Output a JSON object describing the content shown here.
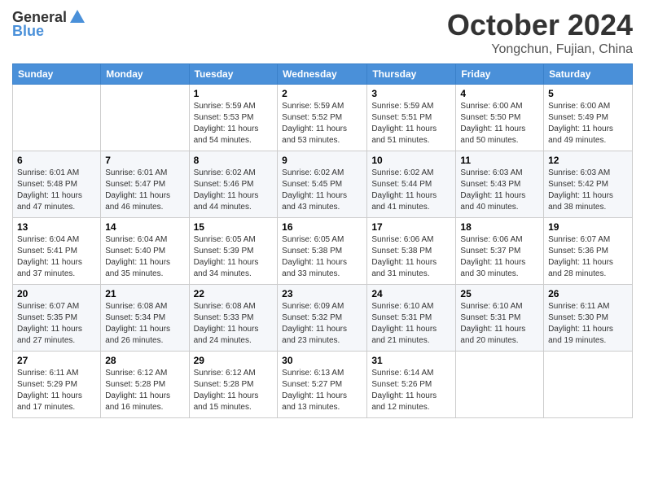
{
  "logo": {
    "general": "General",
    "blue": "Blue"
  },
  "title": "October 2024",
  "location": "Yongchun, Fujian, China",
  "days_of_week": [
    "Sunday",
    "Monday",
    "Tuesday",
    "Wednesday",
    "Thursday",
    "Friday",
    "Saturday"
  ],
  "weeks": [
    [
      {
        "day": "",
        "sunrise": "",
        "sunset": "",
        "daylight": ""
      },
      {
        "day": "",
        "sunrise": "",
        "sunset": "",
        "daylight": ""
      },
      {
        "day": "1",
        "sunrise": "Sunrise: 5:59 AM",
        "sunset": "Sunset: 5:53 PM",
        "daylight": "Daylight: 11 hours and 54 minutes."
      },
      {
        "day": "2",
        "sunrise": "Sunrise: 5:59 AM",
        "sunset": "Sunset: 5:52 PM",
        "daylight": "Daylight: 11 hours and 53 minutes."
      },
      {
        "day": "3",
        "sunrise": "Sunrise: 5:59 AM",
        "sunset": "Sunset: 5:51 PM",
        "daylight": "Daylight: 11 hours and 51 minutes."
      },
      {
        "day": "4",
        "sunrise": "Sunrise: 6:00 AM",
        "sunset": "Sunset: 5:50 PM",
        "daylight": "Daylight: 11 hours and 50 minutes."
      },
      {
        "day": "5",
        "sunrise": "Sunrise: 6:00 AM",
        "sunset": "Sunset: 5:49 PM",
        "daylight": "Daylight: 11 hours and 49 minutes."
      }
    ],
    [
      {
        "day": "6",
        "sunrise": "Sunrise: 6:01 AM",
        "sunset": "Sunset: 5:48 PM",
        "daylight": "Daylight: 11 hours and 47 minutes."
      },
      {
        "day": "7",
        "sunrise": "Sunrise: 6:01 AM",
        "sunset": "Sunset: 5:47 PM",
        "daylight": "Daylight: 11 hours and 46 minutes."
      },
      {
        "day": "8",
        "sunrise": "Sunrise: 6:02 AM",
        "sunset": "Sunset: 5:46 PM",
        "daylight": "Daylight: 11 hours and 44 minutes."
      },
      {
        "day": "9",
        "sunrise": "Sunrise: 6:02 AM",
        "sunset": "Sunset: 5:45 PM",
        "daylight": "Daylight: 11 hours and 43 minutes."
      },
      {
        "day": "10",
        "sunrise": "Sunrise: 6:02 AM",
        "sunset": "Sunset: 5:44 PM",
        "daylight": "Daylight: 11 hours and 41 minutes."
      },
      {
        "day": "11",
        "sunrise": "Sunrise: 6:03 AM",
        "sunset": "Sunset: 5:43 PM",
        "daylight": "Daylight: 11 hours and 40 minutes."
      },
      {
        "day": "12",
        "sunrise": "Sunrise: 6:03 AM",
        "sunset": "Sunset: 5:42 PM",
        "daylight": "Daylight: 11 hours and 38 minutes."
      }
    ],
    [
      {
        "day": "13",
        "sunrise": "Sunrise: 6:04 AM",
        "sunset": "Sunset: 5:41 PM",
        "daylight": "Daylight: 11 hours and 37 minutes."
      },
      {
        "day": "14",
        "sunrise": "Sunrise: 6:04 AM",
        "sunset": "Sunset: 5:40 PM",
        "daylight": "Daylight: 11 hours and 35 minutes."
      },
      {
        "day": "15",
        "sunrise": "Sunrise: 6:05 AM",
        "sunset": "Sunset: 5:39 PM",
        "daylight": "Daylight: 11 hours and 34 minutes."
      },
      {
        "day": "16",
        "sunrise": "Sunrise: 6:05 AM",
        "sunset": "Sunset: 5:38 PM",
        "daylight": "Daylight: 11 hours and 33 minutes."
      },
      {
        "day": "17",
        "sunrise": "Sunrise: 6:06 AM",
        "sunset": "Sunset: 5:38 PM",
        "daylight": "Daylight: 11 hours and 31 minutes."
      },
      {
        "day": "18",
        "sunrise": "Sunrise: 6:06 AM",
        "sunset": "Sunset: 5:37 PM",
        "daylight": "Daylight: 11 hours and 30 minutes."
      },
      {
        "day": "19",
        "sunrise": "Sunrise: 6:07 AM",
        "sunset": "Sunset: 5:36 PM",
        "daylight": "Daylight: 11 hours and 28 minutes."
      }
    ],
    [
      {
        "day": "20",
        "sunrise": "Sunrise: 6:07 AM",
        "sunset": "Sunset: 5:35 PM",
        "daylight": "Daylight: 11 hours and 27 minutes."
      },
      {
        "day": "21",
        "sunrise": "Sunrise: 6:08 AM",
        "sunset": "Sunset: 5:34 PM",
        "daylight": "Daylight: 11 hours and 26 minutes."
      },
      {
        "day": "22",
        "sunrise": "Sunrise: 6:08 AM",
        "sunset": "Sunset: 5:33 PM",
        "daylight": "Daylight: 11 hours and 24 minutes."
      },
      {
        "day": "23",
        "sunrise": "Sunrise: 6:09 AM",
        "sunset": "Sunset: 5:32 PM",
        "daylight": "Daylight: 11 hours and 23 minutes."
      },
      {
        "day": "24",
        "sunrise": "Sunrise: 6:10 AM",
        "sunset": "Sunset: 5:31 PM",
        "daylight": "Daylight: 11 hours and 21 minutes."
      },
      {
        "day": "25",
        "sunrise": "Sunrise: 6:10 AM",
        "sunset": "Sunset: 5:31 PM",
        "daylight": "Daylight: 11 hours and 20 minutes."
      },
      {
        "day": "26",
        "sunrise": "Sunrise: 6:11 AM",
        "sunset": "Sunset: 5:30 PM",
        "daylight": "Daylight: 11 hours and 19 minutes."
      }
    ],
    [
      {
        "day": "27",
        "sunrise": "Sunrise: 6:11 AM",
        "sunset": "Sunset: 5:29 PM",
        "daylight": "Daylight: 11 hours and 17 minutes."
      },
      {
        "day": "28",
        "sunrise": "Sunrise: 6:12 AM",
        "sunset": "Sunset: 5:28 PM",
        "daylight": "Daylight: 11 hours and 16 minutes."
      },
      {
        "day": "29",
        "sunrise": "Sunrise: 6:12 AM",
        "sunset": "Sunset: 5:28 PM",
        "daylight": "Daylight: 11 hours and 15 minutes."
      },
      {
        "day": "30",
        "sunrise": "Sunrise: 6:13 AM",
        "sunset": "Sunset: 5:27 PM",
        "daylight": "Daylight: 11 hours and 13 minutes."
      },
      {
        "day": "31",
        "sunrise": "Sunrise: 6:14 AM",
        "sunset": "Sunset: 5:26 PM",
        "daylight": "Daylight: 11 hours and 12 minutes."
      },
      {
        "day": "",
        "sunrise": "",
        "sunset": "",
        "daylight": ""
      },
      {
        "day": "",
        "sunrise": "",
        "sunset": "",
        "daylight": ""
      }
    ]
  ]
}
